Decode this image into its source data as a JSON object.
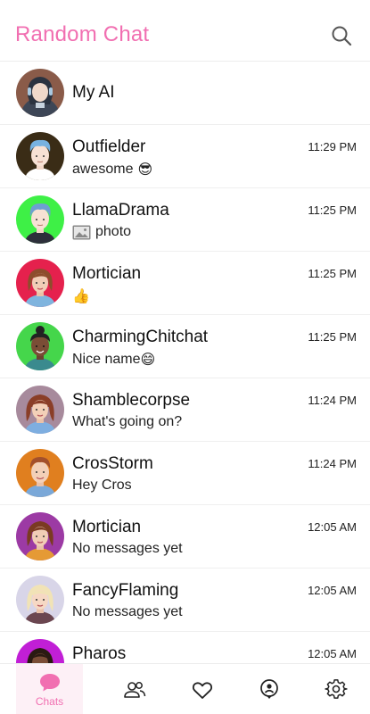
{
  "header": {
    "title": "Random Chat",
    "search_icon": "search-icon"
  },
  "colors": {
    "accent": "#f16fb1"
  },
  "chats": [
    {
      "name": "My AI",
      "message": "",
      "time": "",
      "avatar_bg": "#8a5b49",
      "icon": "robot-avatar"
    },
    {
      "name": "Outfielder",
      "message": "awesome",
      "emoji": "😎",
      "time": "11:29 PM",
      "avatar_bg": "#3a2c16"
    },
    {
      "name": "LlamaDrama",
      "message": "photo",
      "time": "11:25 PM",
      "avatar_bg": "#3ef046",
      "icon": "image-icon"
    },
    {
      "name": "Mortician",
      "message": "",
      "emoji": "👍",
      "time": "11:25 PM",
      "avatar_bg": "#e5214d"
    },
    {
      "name": "CharmingChitchat",
      "message": "Nice name",
      "emoji": "😄",
      "time": "11:25 PM",
      "avatar_bg": "#45d64b"
    },
    {
      "name": "Shamblecorpse",
      "message": "What's going on?",
      "time": "11:24 PM",
      "avatar_bg": "#a78a9c"
    },
    {
      "name": "CrosStorm",
      "message": "Hey Cros",
      "time": "11:24 PM",
      "avatar_bg": "#e07f1f"
    },
    {
      "name": "Mortician",
      "message": "No messages yet",
      "time": "12:05 AM",
      "avatar_bg": "#9c3aa4"
    },
    {
      "name": "FancyFlaming",
      "message": "No messages yet",
      "time": "12:05 AM",
      "avatar_bg": "#d8d5e8"
    },
    {
      "name": "Pharos",
      "message": "",
      "time": "12:05 AM",
      "avatar_bg": "#c11fd6"
    }
  ],
  "nav": {
    "chats_label": "Chats",
    "items": [
      "chat-bubble-icon",
      "people-icon",
      "heart-icon",
      "location-icon",
      "gear-icon"
    ]
  }
}
